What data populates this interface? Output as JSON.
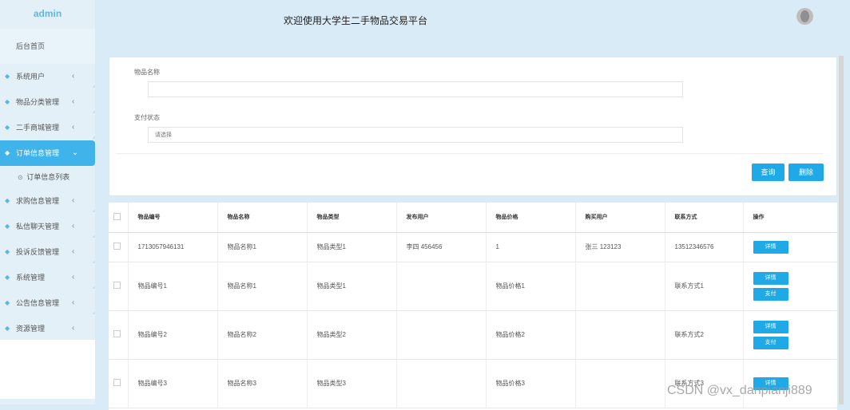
{
  "app": {
    "brand": "admin",
    "title": "欢迎使用大学生二手物品交易平台"
  },
  "sidebar": {
    "home": "后台首页",
    "items": [
      {
        "label": "系统用户",
        "icon": "gem-icon",
        "active": false
      },
      {
        "label": "物品分类管理",
        "icon": "gem-icon",
        "active": false
      },
      {
        "label": "二手商城管理",
        "icon": "gem-icon",
        "active": false
      },
      {
        "label": "订单信息管理",
        "icon": "gem-icon",
        "active": true
      },
      {
        "label": "求购信息管理",
        "icon": "gem-icon",
        "active": false
      },
      {
        "label": "私信聊天管理",
        "icon": "gem-icon",
        "active": false
      },
      {
        "label": "投诉反馈管理",
        "icon": "gem-icon",
        "active": false
      },
      {
        "label": "系统管理",
        "icon": "gem-icon",
        "active": false
      },
      {
        "label": "公告信息管理",
        "icon": "gem-icon",
        "active": false
      },
      {
        "label": "资源管理",
        "icon": "gem-icon",
        "active": false
      }
    ],
    "subitem": "订单信息列表"
  },
  "search": {
    "name_label": "物品名称",
    "name_value": "",
    "pay_label": "支付状态",
    "pay_placeholder": "请选择",
    "query_button": "查询",
    "delete_button": "删除"
  },
  "table": {
    "headers": [
      "物品编号",
      "物品名称",
      "物品类型",
      "发布用户",
      "物品价格",
      "购买用户",
      "联系方式",
      "操作"
    ],
    "rows": [
      {
        "cells": [
          "1713057946131",
          "物品名称1",
          "物品类型1",
          "李四 456456",
          "1",
          "张三 123123",
          "13512346576"
        ],
        "actions": [
          "详情"
        ]
      },
      {
        "cells": [
          "物品编号1",
          "物品名称1",
          "物品类型1",
          "",
          "物品价格1",
          "",
          "联系方式1"
        ],
        "actions": [
          "详情",
          "支付"
        ]
      },
      {
        "cells": [
          "物品编号2",
          "物品名称2",
          "物品类型2",
          "",
          "物品价格2",
          "",
          "联系方式2"
        ],
        "actions": [
          "详情",
          "支付"
        ]
      },
      {
        "cells": [
          "物品编号3",
          "物品名称3",
          "物品类型3",
          "",
          "物品价格3",
          "",
          "联系方式3"
        ],
        "actions": [
          "详情"
        ]
      }
    ]
  },
  "watermark": "CSDN @vx_danpianji889",
  "colors": {
    "accent": "#1fa9e6",
    "sidebar_active": "#3fb3ea",
    "background": "#d9ebf6"
  }
}
